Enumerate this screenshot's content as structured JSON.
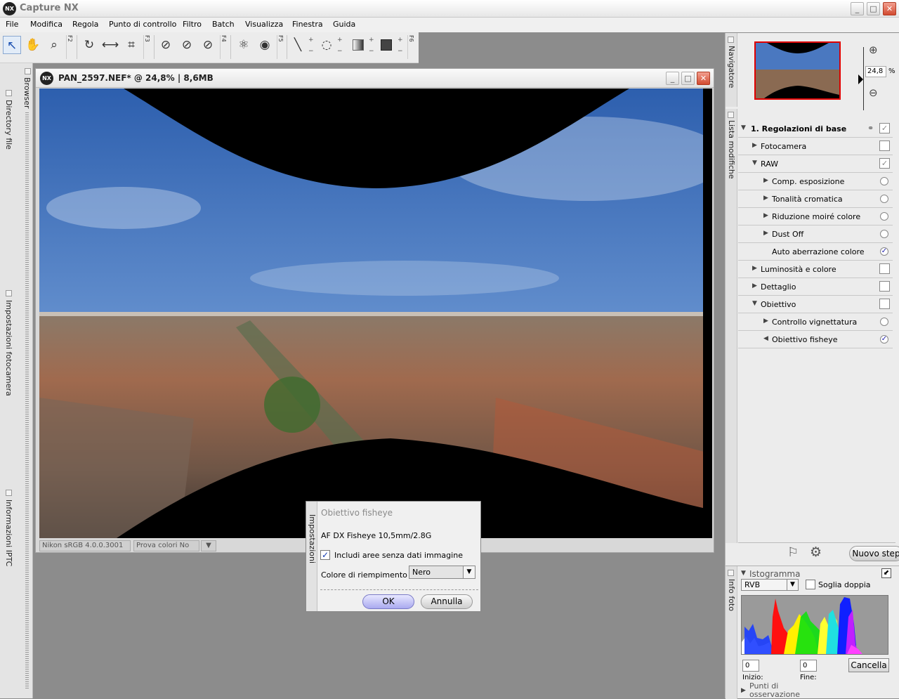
{
  "app": {
    "title": "Capture NX",
    "logo": "NX",
    "buttons": {
      "minimize": "_",
      "maximize": "□",
      "close": "✕"
    }
  },
  "menu": [
    "File",
    "Modifica",
    "Regola",
    "Punto di controllo",
    "Filtro",
    "Batch",
    "Visualizza",
    "Finestra",
    "Guida"
  ],
  "toolbar": {
    "fkeys": [
      "F2",
      "F3",
      "F4",
      "F5",
      "F6"
    ]
  },
  "left_tabs": [
    "Browser",
    "Directory file",
    "Impostazioni fotocamera",
    "Informazioni IPTC"
  ],
  "document": {
    "logo": "NX",
    "title": "PAN_2597.NEF* @ 24,8% | 8,6MB",
    "status_profile": "Nikon sRGB 4.0.0.3001",
    "status_proof": "Prova colori No"
  },
  "dialog": {
    "side_label": "Impostazioni",
    "title": "Obiettivo fisheye",
    "lens": "AF DX Fisheye 10,5mm/2.8G",
    "checkbox_label": "Includi aree senza dati immagine",
    "checkbox_checked": true,
    "fill_label": "Colore di riempimento",
    "fill_value": "Nero",
    "ok": "OK",
    "cancel": "Annulla"
  },
  "navigator": {
    "label": "Navigatore",
    "zoom": "24,8",
    "unit": "%"
  },
  "edit_list": {
    "label": "Lista modifiche",
    "steps": [
      {
        "level": 0,
        "label": "1. Regolazioni di base",
        "expanded": true,
        "control": "checkbox",
        "checked": true
      },
      {
        "level": 1,
        "label": "Fotocamera",
        "expanded": false,
        "control": "checkbox",
        "checked": false
      },
      {
        "level": 1,
        "label": "RAW",
        "expanded": true,
        "control": "checkbox",
        "checked": true
      },
      {
        "level": 2,
        "label": "Comp. esposizione",
        "expanded": false,
        "control": "radio",
        "checked": false
      },
      {
        "level": 2,
        "label": "Tonalità cromatica",
        "expanded": false,
        "control": "radio",
        "checked": false
      },
      {
        "level": 2,
        "label": "Riduzione moiré colore",
        "expanded": false,
        "control": "radio",
        "checked": false
      },
      {
        "level": 2,
        "label": "Dust Off",
        "expanded": false,
        "control": "radio",
        "checked": false
      },
      {
        "level": 2,
        "label": "Auto aberrazione colore",
        "expanded": null,
        "control": "radio",
        "checked": true
      },
      {
        "level": 1,
        "label": "Luminosità e colore",
        "expanded": false,
        "control": "checkbox",
        "checked": false
      },
      {
        "level": 1,
        "label": "Dettaglio",
        "expanded": false,
        "control": "checkbox",
        "checked": false
      },
      {
        "level": 1,
        "label": "Obiettivo",
        "expanded": true,
        "control": "checkbox",
        "checked": false
      },
      {
        "level": 2,
        "label": "Controllo vignettatura",
        "expanded": false,
        "control": "radio",
        "checked": false
      },
      {
        "level": 2,
        "label": "Obiettivo fisheye",
        "expanded": "open",
        "control": "radio",
        "checked": true
      }
    ],
    "new_step": "Nuovo step"
  },
  "histogram": {
    "side_label": "Info foto",
    "title": "Istogramma",
    "channel": "RVB",
    "double_label": "Soglia doppia",
    "inizio_value": "0",
    "fine_value": "0",
    "inizio_label": "Inizio:",
    "fine_label": "Fine:",
    "cancel": "Cancella",
    "points_label": "Punti di osservazione"
  }
}
